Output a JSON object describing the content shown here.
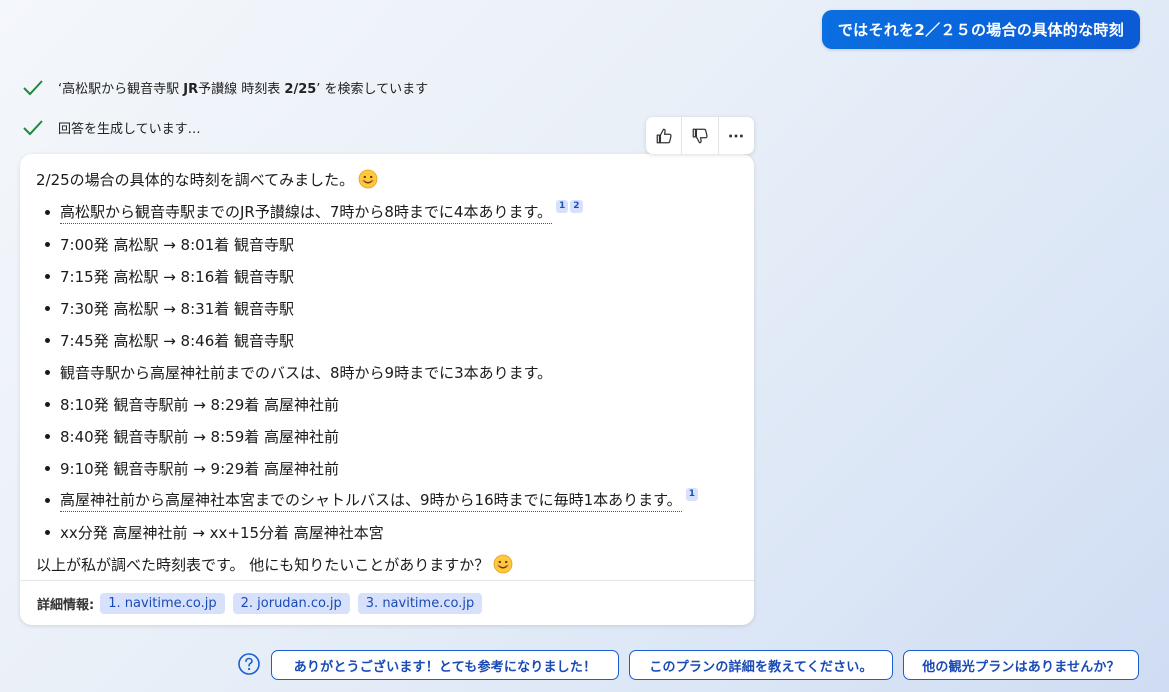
{
  "user_message": "ではそれを2／２５の場合の具体的な時刻",
  "progress": {
    "search_prefix": "‘",
    "search_plain": "高松駅から観音寺駅 ",
    "search_bold": "JR",
    "search_plain2": "予讃線 時刻表 ",
    "search_bold2": "2/25",
    "search_suffix": "’ を検索しています",
    "generating": "回答を生成しています…"
  },
  "answer": {
    "intro": "2/25の場合の具体的な時刻を調べてみました。",
    "items": [
      {
        "text": "高松駅から観音寺駅までのJR予讃線は、7時から8時までに4本あります。",
        "cited": true,
        "cites": [
          "1",
          "2"
        ]
      },
      {
        "text": "7:00発 高松駅 → 8:01着 観音寺駅"
      },
      {
        "text": "7:15発 高松駅 → 8:16着 観音寺駅"
      },
      {
        "text": "7:30発 高松駅 → 8:31着 観音寺駅"
      },
      {
        "text": "7:45発 高松駅 → 8:46着 観音寺駅"
      },
      {
        "text": "観音寺駅から高屋神社前までのバスは、8時から9時までに3本あります。"
      },
      {
        "text": "8:10発 観音寺駅前 → 8:29着 高屋神社前"
      },
      {
        "text": "8:40発 観音寺駅前 → 8:59着 高屋神社前"
      },
      {
        "text": "9:10発 観音寺駅前 → 9:29着 高屋神社前"
      },
      {
        "text": "高屋神社前から高屋神社本宮までのシャトルバスは、9時から16時までに毎時1本あります。",
        "cited": true,
        "cites": [
          "1"
        ]
      },
      {
        "text": "xx分発 高屋神社前 → xx+15分着 高屋神社本宮"
      }
    ],
    "outro": "以上が私が調べた時刻表です。 他にも知りたいことがありますか？"
  },
  "footer": {
    "label": "詳細情報:",
    "sources": [
      "1. navitime.co.jp",
      "2. jorudan.co.jp",
      "3. navitime.co.jp"
    ]
  },
  "suggestions": [
    "ありがとうございます！とても参考になりました！",
    "このプランの詳細を教えてください。",
    "他の観光プランはありませんか？"
  ],
  "colors": {
    "accent": "#0b5ad6",
    "check": "#1e8a3c",
    "chip_bg": "#d7e1fb"
  }
}
